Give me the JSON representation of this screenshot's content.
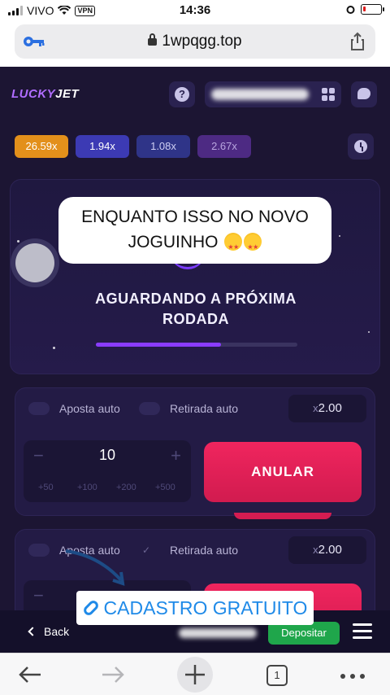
{
  "status_bar": {
    "carrier": "VIVO",
    "vpn": "VPN",
    "time": "14:36"
  },
  "browser": {
    "url": "1wpqgg.top"
  },
  "app": {
    "logo_part1": "LUCKY",
    "logo_part2": "JET",
    "help": "?"
  },
  "history": [
    {
      "value": "26.59x",
      "color": "#e3901b"
    },
    {
      "value": "1.94x",
      "color": "#3c3ab4"
    },
    {
      "value": "1.08x",
      "color": "#2f3488"
    },
    {
      "value": "2.67x",
      "color": "#4d2a83"
    }
  ],
  "game": {
    "status_line1": "AGUARDANDO A PRÓXIMA",
    "status_line2": "RODADA",
    "progress": 0.62
  },
  "story": {
    "line1": "ENQUANTO ISSO NO NOVO",
    "line2": "JOGUINHO"
  },
  "bet_panel_1": {
    "auto_bet_label": "Aposta auto",
    "auto_cashout_label": "Retirada auto",
    "multiplier_prefix": "x",
    "multiplier": "2.00",
    "stake": "10",
    "quick_amounts": [
      "+50",
      "+100",
      "+200",
      "+500"
    ],
    "action": "ANULAR"
  },
  "bet_panel_2": {
    "auto_bet_label": "Aposta auto",
    "auto_cashout_label": "Retirada auto",
    "multiplier_prefix": "x",
    "multiplier": "2.00"
  },
  "overlay": {
    "cadastro": "CADASTRO GRATUITO"
  },
  "game_nav": {
    "back": "Back",
    "deposit": "Depositar"
  },
  "toolbar": {
    "tabs_count": "1"
  }
}
